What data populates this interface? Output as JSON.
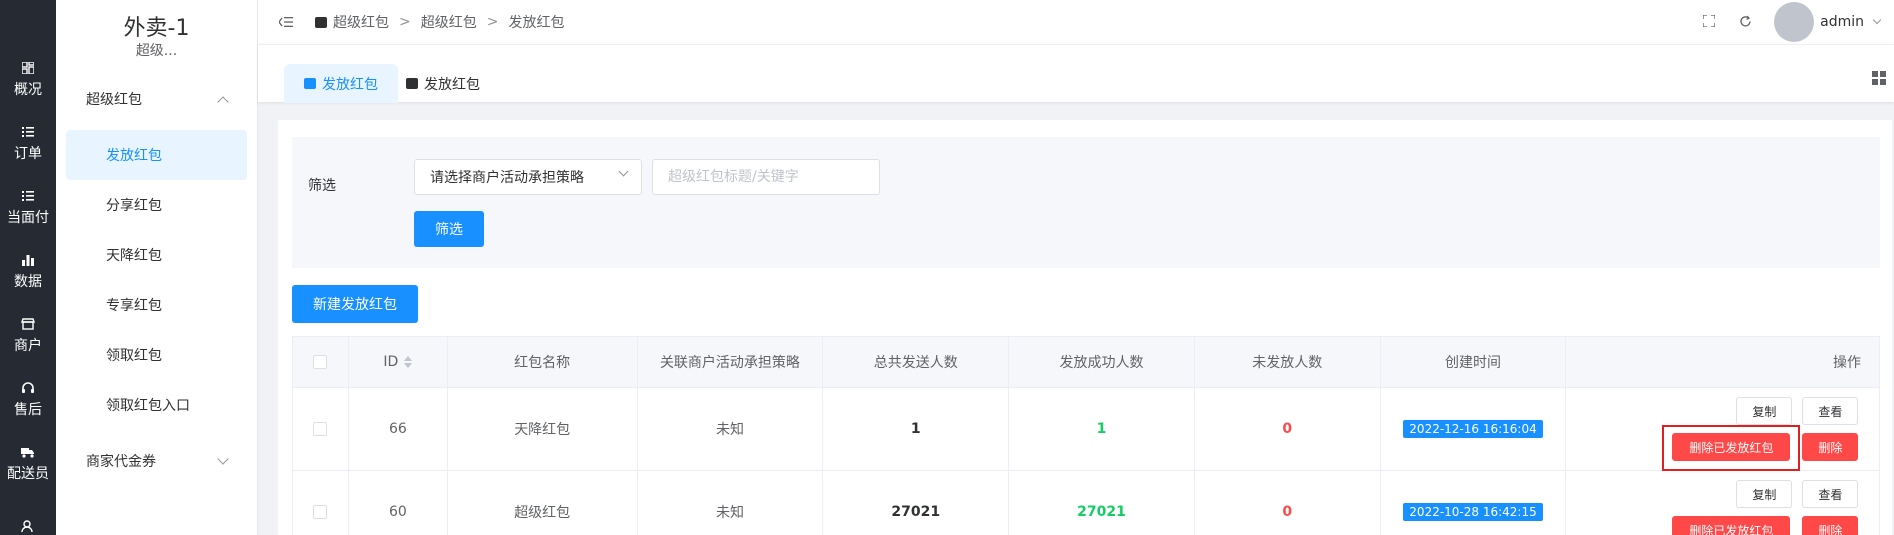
{
  "rail": {
    "items": [
      {
        "label": "概况",
        "icon": "dashboard-icon"
      },
      {
        "label": "订单",
        "icon": "list-icon"
      },
      {
        "label": "当面付",
        "icon": "list-icon"
      },
      {
        "label": "数据",
        "icon": "bar-chart-icon"
      },
      {
        "label": "商户",
        "icon": "shop-icon"
      },
      {
        "label": "售后",
        "icon": "headset-icon"
      },
      {
        "label": "配送员",
        "icon": "delivery-icon"
      },
      {
        "label": "",
        "icon": "users-icon"
      }
    ]
  },
  "sidebar": {
    "shop_name": "外卖-1",
    "shop_sub": "超级...",
    "group1": "超级红包",
    "items": [
      {
        "label": "发放红包",
        "active": true
      },
      {
        "label": "分享红包",
        "active": false
      },
      {
        "label": "天降红包",
        "active": false
      },
      {
        "label": "专享红包",
        "active": false
      },
      {
        "label": "领取红包",
        "active": false
      },
      {
        "label": "领取红包入口",
        "active": false
      }
    ],
    "group2": "商家代金券"
  },
  "header": {
    "breadcrumb": [
      "超级红包",
      "超级红包",
      "发放红包"
    ],
    "user": "admin"
  },
  "tabs": [
    {
      "label": "发放红包",
      "active": true
    },
    {
      "label": "发放红包",
      "active": false
    }
  ],
  "filter": {
    "label": "筛选",
    "select_value": "请选择商户活动承担策略",
    "keyword_placeholder": "超级红包标题/关键字",
    "button": "筛选"
  },
  "new_button": "新建发放红包",
  "table": {
    "headers": [
      "",
      "ID",
      "红包名称",
      "关联商户活动承担策略",
      "总共发送人数",
      "发放成功人数",
      "未发放人数",
      "创建时间",
      "操作"
    ],
    "rows": [
      {
        "id": "66",
        "name": "天降红包",
        "strategy": "未知",
        "total": "1",
        "success": "1",
        "pending": "0",
        "created": "2022-12-16 16:16:04"
      },
      {
        "id": "60",
        "name": "超级红包",
        "strategy": "未知",
        "total": "27021",
        "success": "27021",
        "pending": "0",
        "created": "2022-10-28 16:42:15"
      }
    ],
    "ops": {
      "copy": "复制",
      "view": "查看",
      "delete_sent": "删除已发放红包",
      "delete": "删除"
    }
  },
  "colors": {
    "primary": "#1890ff",
    "danger": "#ff4949",
    "success": "#13ce66",
    "rail_bg": "#262b33",
    "highlight": "#e02020"
  }
}
